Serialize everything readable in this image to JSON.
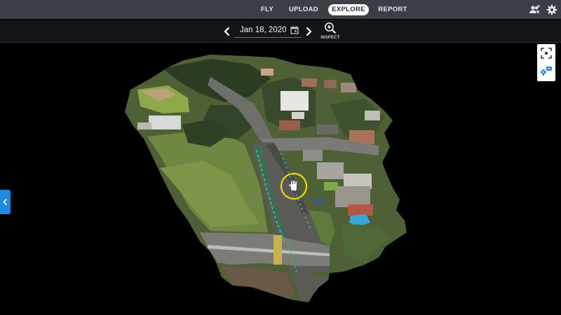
{
  "nav": {
    "tabs": [
      "FLY",
      "UPLOAD",
      "EXPLORE",
      "REPORT"
    ],
    "active": "EXPLORE"
  },
  "header_icons": [
    "users-icon",
    "gear-icon"
  ],
  "datebar": {
    "date": "Jan 18, 2020",
    "inspect_label": "INSPECT"
  },
  "tools": [
    "focus-frame-icon",
    "layers-badge-icon"
  ],
  "sidebar_toggle": "chevron-left-icon",
  "colors": {
    "nav_bg": "#3a3f45",
    "datebar_bg": "#121417",
    "accent_blue": "#1e88e5",
    "marker_yellow": "#f2d90a"
  }
}
